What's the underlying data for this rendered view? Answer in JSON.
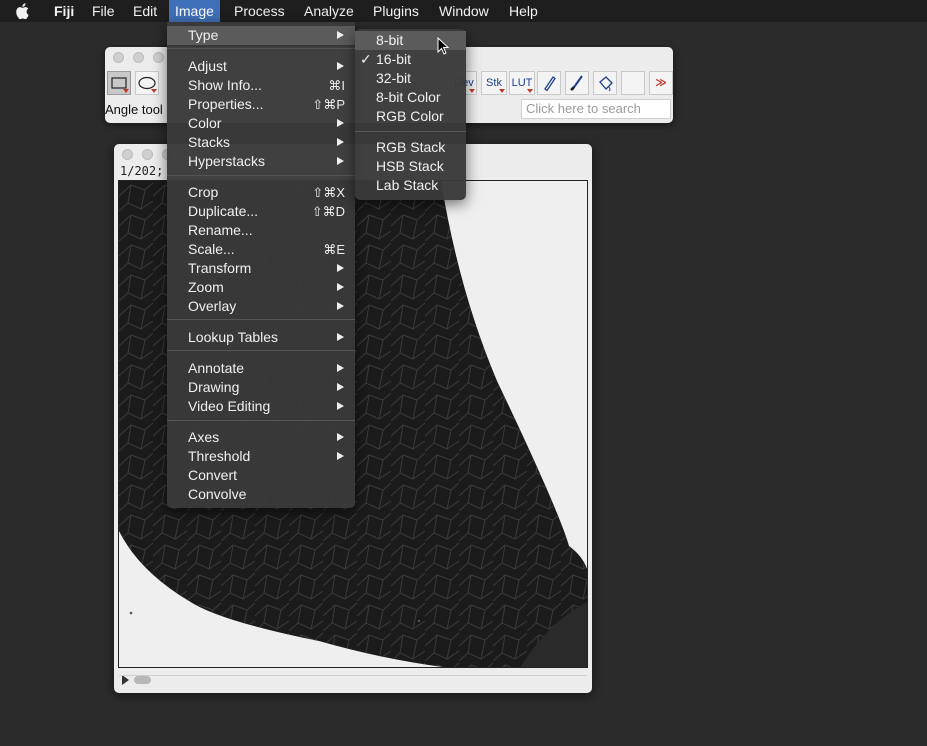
{
  "menubar": {
    "apple_icon": "apple-icon",
    "app_name": "Fiji",
    "items": [
      "File",
      "Edit",
      "Image",
      "Process",
      "Analyze",
      "Plugins",
      "Window",
      "Help"
    ],
    "active": "Image"
  },
  "toolbar": {
    "status_text": "Angle tool",
    "search_placeholder": "Click here to search",
    "stk_label": "Stk",
    "lut_label": "LUT",
    "dev_label": "Dev",
    "more_label": "≫",
    "tool_icons": [
      "rectangle-selection-icon",
      "oval-selection-icon",
      "pencil-icon",
      "brush-icon",
      "flood-fill-icon"
    ]
  },
  "image_window": {
    "info": "1/202;"
  },
  "image_menu": {
    "items": [
      {
        "label": "Type",
        "submenu": true,
        "highlighted": true
      },
      {
        "label": "Adjust",
        "submenu": true
      },
      {
        "label": "Show Info...",
        "shortcut": "⌘I"
      },
      {
        "label": "Properties...",
        "shortcut": "⇧⌘P"
      },
      {
        "label": "Color",
        "submenu": true
      },
      {
        "label": "Stacks",
        "submenu": true
      },
      {
        "label": "Hyperstacks",
        "submenu": true
      },
      {
        "label": "Crop",
        "shortcut": "⇧⌘X"
      },
      {
        "label": "Duplicate...",
        "shortcut": "⇧⌘D"
      },
      {
        "label": "Rename..."
      },
      {
        "label": "Scale...",
        "shortcut": "⌘E"
      },
      {
        "label": "Transform",
        "submenu": true
      },
      {
        "label": "Zoom",
        "submenu": true
      },
      {
        "label": "Overlay",
        "submenu": true
      },
      {
        "label": "Lookup Tables",
        "submenu": true
      },
      {
        "label": "Annotate",
        "submenu": true
      },
      {
        "label": "Drawing",
        "submenu": true
      },
      {
        "label": "Video Editing",
        "submenu": true
      },
      {
        "label": "Axes",
        "submenu": true
      },
      {
        "label": "Threshold",
        "submenu": true
      },
      {
        "label": "Convert"
      },
      {
        "label": "Convolve"
      }
    ]
  },
  "type_submenu": {
    "items": [
      {
        "label": "8-bit",
        "highlighted": true
      },
      {
        "label": "16-bit",
        "checked": true
      },
      {
        "label": "32-bit"
      },
      {
        "label": "8-bit Color"
      },
      {
        "label": "RGB Color"
      },
      {
        "label": "RGB Stack"
      },
      {
        "label": "HSB Stack"
      },
      {
        "label": "Lab Stack"
      }
    ],
    "check_glyph": "✓"
  }
}
